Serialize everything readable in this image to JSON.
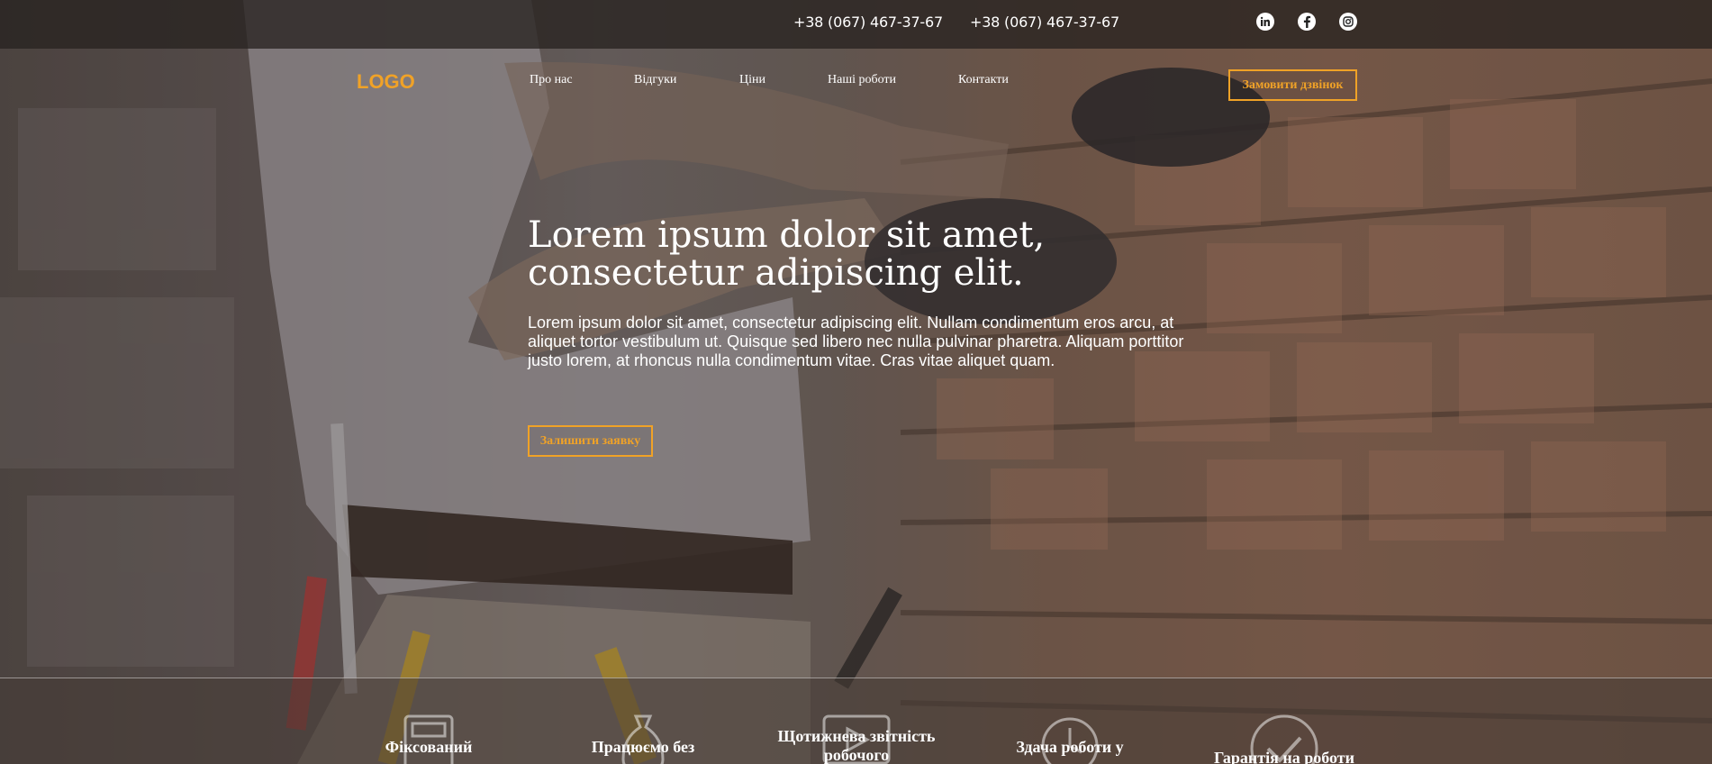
{
  "topbar": {
    "phones": [
      "+38 (067) 467-37-67",
      "+38 (067) 467-37-67"
    ],
    "social": [
      "linkedin-icon",
      "facebook-icon",
      "instagram-icon"
    ]
  },
  "nav": {
    "logo": "LOGO",
    "items": [
      "Про нас",
      "Відгуки",
      "Ціни",
      "Наші роботи",
      "Контакти"
    ],
    "call_button": "Замовити дзвінок"
  },
  "hero": {
    "title": "Lorem ipsum dolor sit amet, consectetur adipiscing elit.",
    "text": "Lorem ipsum dolor sit amet, consectetur adipiscing elit. Nullam condimentum eros arcu, at aliquet tortor vestibulum ut. Quisque sed libero nec nulla pulvinar pharetra. Aliquam porttitor justo lorem, at rhoncus nulla condimentum vitae. Cras vitae aliquet quam.",
    "button": "Залишити заявку"
  },
  "features": [
    {
      "label": "Фіксований",
      "icon": "calculator-icon"
    },
    {
      "label": "Працюємо без",
      "icon": "money-bag-icon"
    },
    {
      "label": "Щотижнева звітність робочого",
      "icon": "video-report-icon"
    },
    {
      "label": "Здача роботи у",
      "icon": "clock-icon"
    },
    {
      "label": "Гарантія на роботи",
      "icon": "checkmark-icon"
    }
  ],
  "colors": {
    "accent": "#f0a227",
    "topbar": "#282220",
    "text": "#ffffff"
  }
}
